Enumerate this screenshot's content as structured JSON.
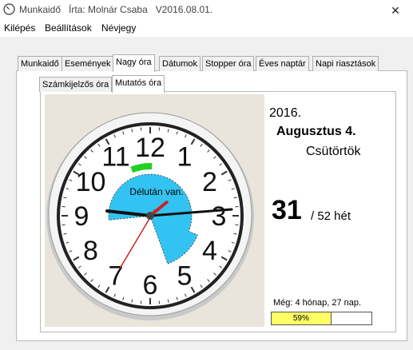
{
  "window": {
    "title": "Munkaidő   Írta: Molnár Csaba   V2016.08.01.",
    "close_glyph": "✕"
  },
  "menu": {
    "items": [
      "Kilépés",
      "Beállítások",
      "Névjegy"
    ]
  },
  "tabs": {
    "main": [
      "Munkaidő",
      "Események",
      "Nagy óra",
      "Dátumok",
      "Stopper óra",
      "Éves naptár",
      "Napi riasztások"
    ],
    "main_active": "Nagy óra",
    "sub": [
      "Számkijelzős óra",
      "Mutatós óra"
    ],
    "sub_active": "Mutatós óra"
  },
  "clock": {
    "numbers": [
      "12",
      "1",
      "2",
      "3",
      "4",
      "5",
      "6",
      "7",
      "8",
      "9",
      "10",
      "11"
    ],
    "period_text": "Délután van.",
    "segment_color": "#33c3f3",
    "arc_color": "#22d022"
  },
  "date_info": {
    "year": "2016.",
    "date": "Augusztus 4.",
    "weekday": "Csütörtök",
    "week_number": "31",
    "week_of": "/ 52 hét",
    "remaining": "Még: 4 hónap, 27 nap.",
    "year_progress_text": "59%",
    "year_progress": 0.59,
    "progress_color": "#ffff66"
  }
}
